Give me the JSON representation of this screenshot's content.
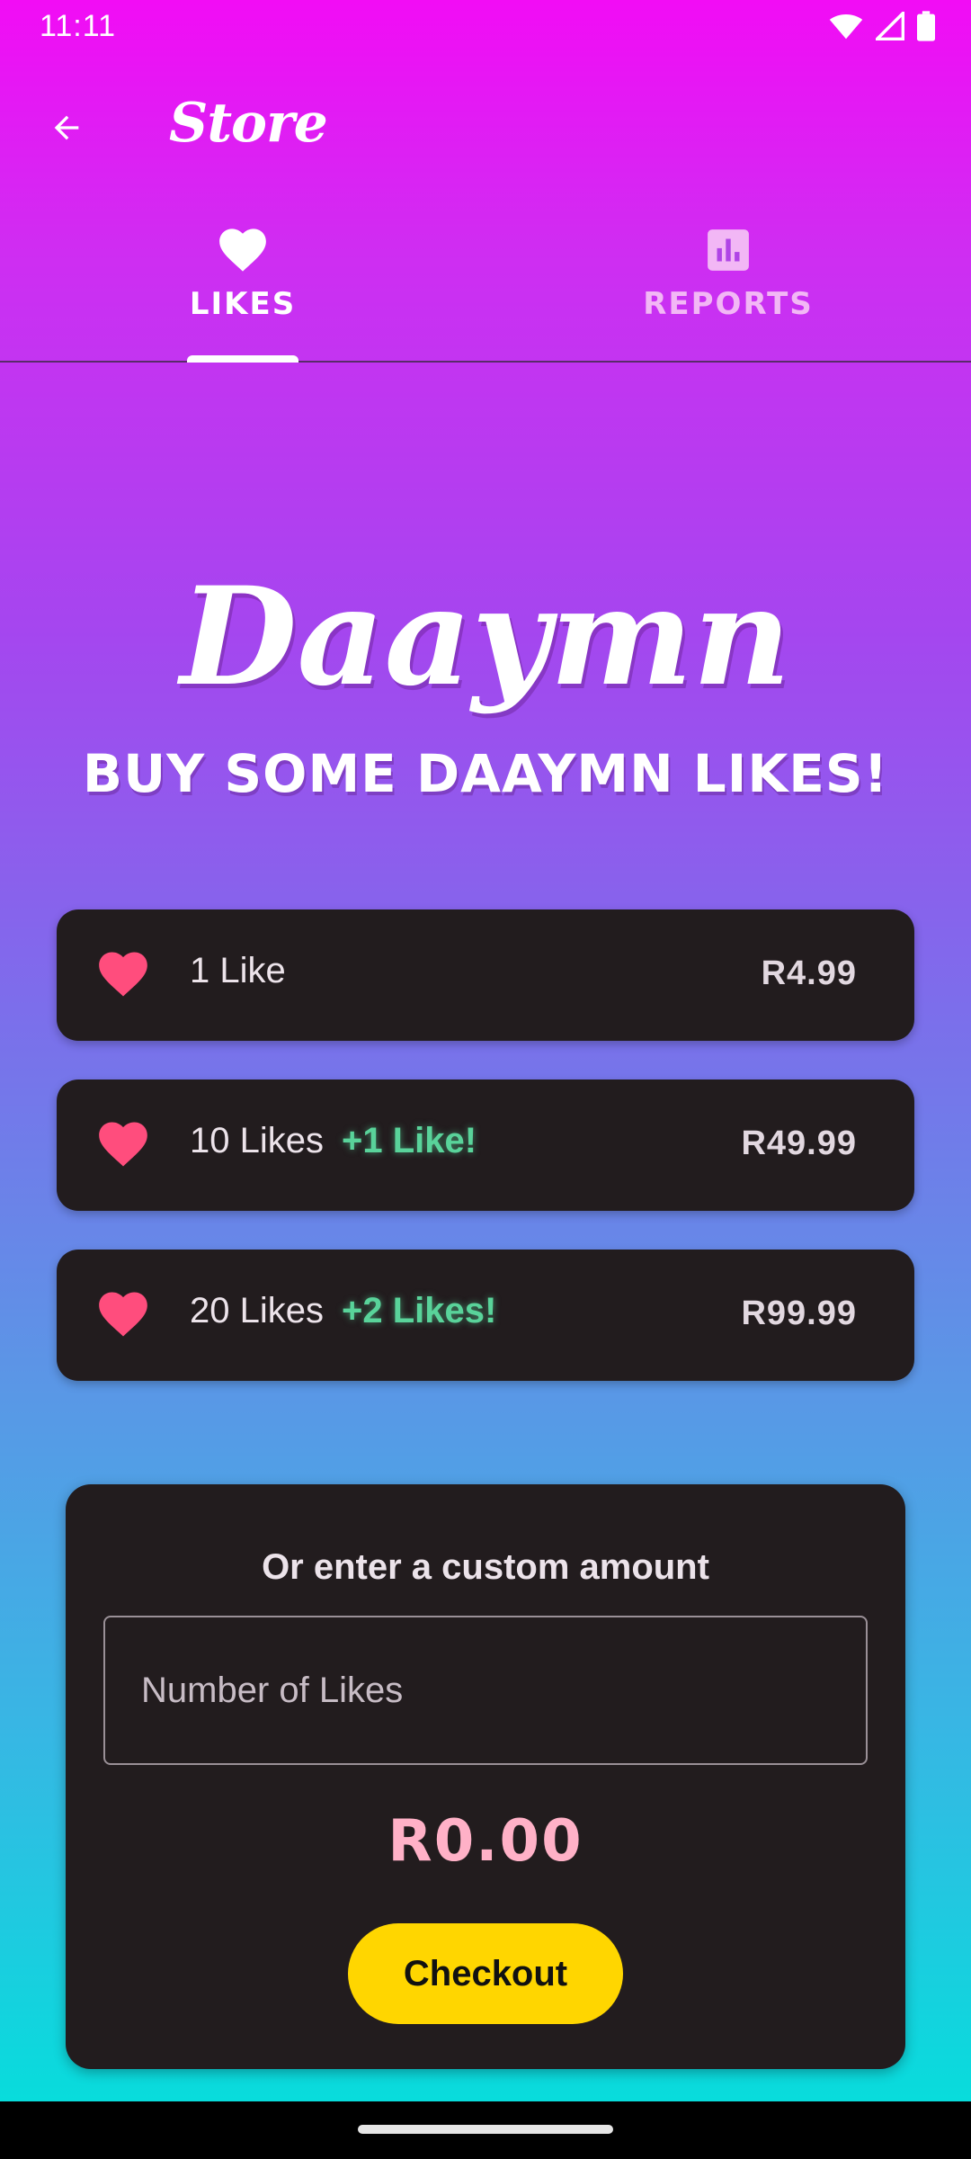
{
  "status_bar": {
    "time": "11:11"
  },
  "app_bar": {
    "title": "Store"
  },
  "tabs": [
    {
      "label": "LIKES",
      "icon": "heart-icon",
      "active": true
    },
    {
      "label": "REPORTS",
      "icon": "bar-chart-icon",
      "active": false
    }
  ],
  "hero": {
    "brand": "Daaymn",
    "headline": "BUY SOME DAAYMN LIKES!"
  },
  "packages": [
    {
      "quantity": "1 Like",
      "bonus": "",
      "price": "R4.99"
    },
    {
      "quantity": "10 Likes",
      "bonus": "+1 Like!",
      "price": "R49.99"
    },
    {
      "quantity": "20 Likes",
      "bonus": "+2 Likes!",
      "price": "R99.99"
    }
  ],
  "custom": {
    "title": "Or enter a custom amount",
    "input_placeholder": "Number of Likes",
    "input_value": "",
    "total": "R0.00",
    "checkout_label": "Checkout"
  },
  "colors": {
    "heart": "#ff4d7d",
    "bonus": "#59d39a",
    "checkout": "#ffd600",
    "card": "#221c1e"
  }
}
